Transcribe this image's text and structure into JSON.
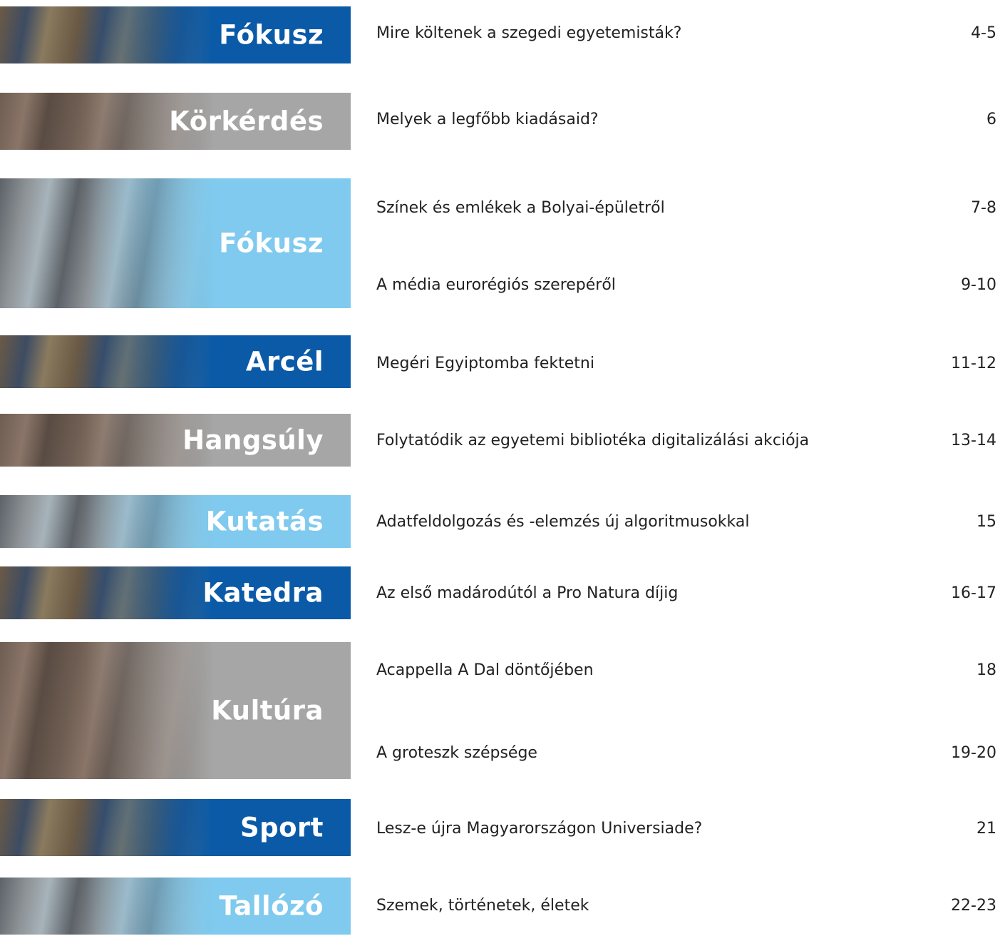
{
  "colors": {
    "dark_blue": "#0a5aa8",
    "light_blue": "#7fcaee",
    "gray": "#a6a6a6"
  },
  "sections": [
    {
      "label": "Fókusz",
      "style": "dark_blue",
      "entries": [
        {
          "title": "Mire költenek a szegedi egyetemisták?",
          "page": "4-5"
        }
      ]
    },
    {
      "label": "Körkérdés",
      "style": "gray",
      "entries": [
        {
          "title": "Melyek a legfőbb kiadásaid?",
          "page": "6"
        }
      ]
    },
    {
      "label": "Fókusz",
      "style": "light_blue",
      "entries": [
        {
          "title": "Színek és emlékek a Bolyai-épületről",
          "page": "7-8"
        },
        {
          "title": "A média eurorégiós szerepéről",
          "page": "9-10"
        }
      ]
    },
    {
      "label": "Arcél",
      "style": "dark_blue",
      "entries": [
        {
          "title": "Megéri Egyiptomba fektetni",
          "page": "11-12"
        }
      ]
    },
    {
      "label": "Hangsúly",
      "style": "gray",
      "entries": [
        {
          "title": "Folytatódik az egyetemi bibliotéka digitalizálási akciója",
          "page": "13-14"
        }
      ]
    },
    {
      "label": "Kutatás",
      "style": "light_blue",
      "entries": [
        {
          "title": "Adatfeldolgozás és -elemzés új algoritmusokkal",
          "page": "15"
        }
      ]
    },
    {
      "label": "Katedra",
      "style": "dark_blue",
      "entries": [
        {
          "title": "Az első madárodútól a Pro Natura díjig",
          "page": "16-17"
        }
      ]
    },
    {
      "label": "Kultúra",
      "style": "gray",
      "entries": [
        {
          "title": "Acappella A Dal döntőjében",
          "page": "18"
        },
        {
          "title": "A groteszk szépsége",
          "page": "19-20"
        }
      ]
    },
    {
      "label": "Sport",
      "style": "dark_blue",
      "entries": [
        {
          "title": "Lesz-e újra Magyarországon Universiade?",
          "page": "21"
        }
      ]
    },
    {
      "label": "Tallózó",
      "style": "light_blue",
      "entries": [
        {
          "title": "Szemek, történetek, életek",
          "page": "22-23"
        }
      ]
    }
  ]
}
